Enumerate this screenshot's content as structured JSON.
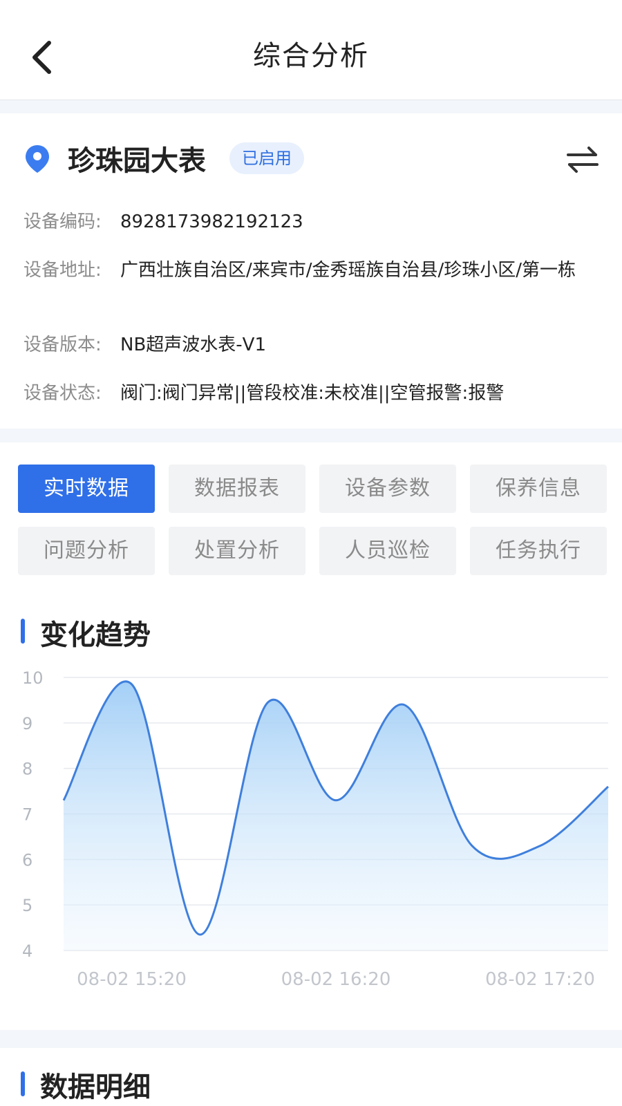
{
  "header": {
    "title": "综合分析"
  },
  "device": {
    "name": "珍珠园大表",
    "status": "已启用",
    "rows": [
      {
        "label": "设备编码:",
        "value": "8928173982192123"
      },
      {
        "label": "设备地址:",
        "value": "广西壮族自治区/来宾市/金秀瑶族自治县/珍珠小区/第一栋"
      },
      {
        "label": "设备版本:",
        "value": "NB超声波水表-V1"
      },
      {
        "label": "设备状态:",
        "value": "阀门:阀门异常||管段校准:未校准||空管报警:报警"
      }
    ]
  },
  "tabs": [
    {
      "label": "实时数据",
      "active": true
    },
    {
      "label": "数据报表",
      "active": false
    },
    {
      "label": "设备参数",
      "active": false
    },
    {
      "label": "保养信息",
      "active": false
    },
    {
      "label": "问题分析",
      "active": false
    },
    {
      "label": "处置分析",
      "active": false
    },
    {
      "label": "人员巡检",
      "active": false
    },
    {
      "label": "任务执行",
      "active": false
    }
  ],
  "trend": {
    "title": "变化趋势"
  },
  "detail": {
    "title": "数据明细"
  },
  "colors": {
    "accent": "#2f6fe8",
    "line": "#3f7fdc"
  },
  "chart_data": {
    "type": "area",
    "title": "",
    "xlabel": "",
    "ylabel": "",
    "ylim": [
      4,
      10
    ],
    "yticks": [
      4,
      5,
      6,
      7,
      8,
      9,
      10
    ],
    "x_tick_labels": [
      "08-02 15:20",
      "08-02 16:20",
      "08-02 17:20"
    ],
    "x": [
      "08-02 15:00",
      "08-02 15:20",
      "08-02 15:40",
      "08-02 16:00",
      "08-02 16:20",
      "08-02 16:40",
      "08-02 17:00",
      "08-02 17:20",
      "08-02 17:40"
    ],
    "values": [
      7.3,
      9.85,
      4.35,
      9.45,
      7.3,
      9.4,
      6.3,
      6.3,
      7.6
    ],
    "grid": true
  }
}
